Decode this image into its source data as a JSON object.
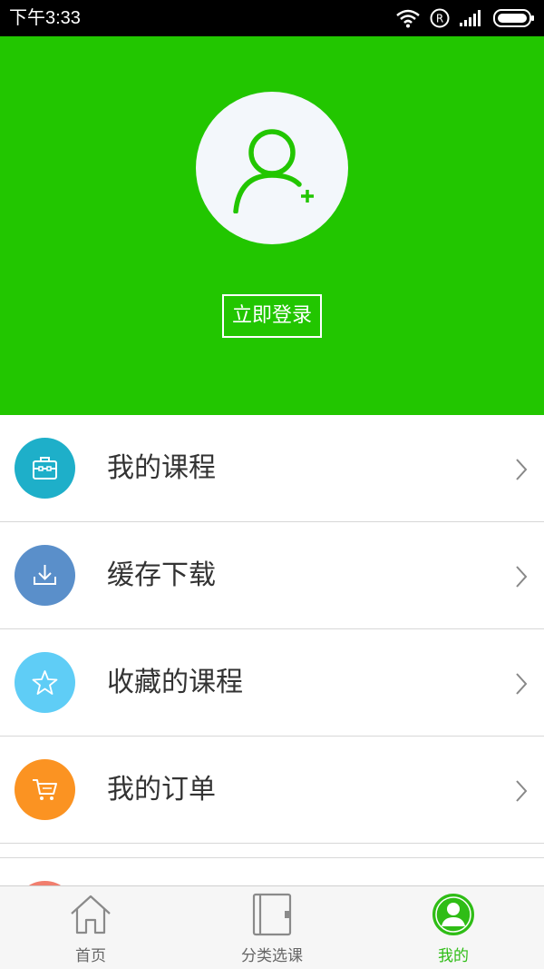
{
  "status_bar": {
    "time": "下午3:33",
    "icons": [
      "wifi-icon",
      "roaming-r-icon",
      "signal-icon",
      "battery-icon"
    ]
  },
  "header": {
    "background_color": "#22c600",
    "avatar_icon": "add-user-icon",
    "login_label": "立即登录"
  },
  "menu": {
    "items": [
      {
        "label": "我的课程",
        "icon": "briefcase-icon",
        "icon_color": "#1eafc9"
      },
      {
        "label": "缓存下载",
        "icon": "download-icon",
        "icon_color": "#5a8fca"
      },
      {
        "label": "收藏的课程",
        "icon": "star-icon",
        "icon_color": "#5fcdf6"
      },
      {
        "label": "我的订单",
        "icon": "cart-icon",
        "icon_color": "#fb9322"
      }
    ]
  },
  "bottom_nav": {
    "active_color": "#2fbd16",
    "items": [
      {
        "label": "首页",
        "icon": "home-icon",
        "active": false
      },
      {
        "label": "分类选课",
        "icon": "notebook-icon",
        "active": false
      },
      {
        "label": "我的",
        "icon": "profile-icon",
        "active": true
      }
    ]
  }
}
